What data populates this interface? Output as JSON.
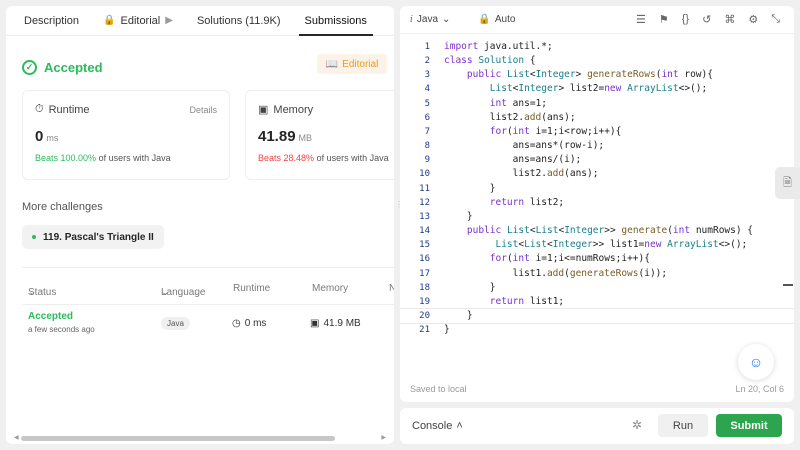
{
  "tabs": [
    {
      "label": "Description"
    },
    {
      "label": "Editorial"
    },
    {
      "label": "Solutions (11.9K)"
    },
    {
      "label": "Submissions"
    }
  ],
  "result": {
    "status": "Accepted",
    "editorial_label": "Editorial",
    "runtime": {
      "label": "Runtime",
      "details": "Details",
      "value": "0",
      "unit": "ms",
      "beats": "Beats 100.00%",
      "suffix": "of users with Java"
    },
    "memory": {
      "label": "Memory",
      "value": "41.89",
      "unit": "MB",
      "beats": "Beats 28.48%",
      "suffix": "of users with Java"
    }
  },
  "more_challenges": {
    "title": "More challenges",
    "items": [
      "119. Pascal's Triangle II"
    ]
  },
  "submissions_table": {
    "headers": [
      "Status",
      "Language",
      "Runtime",
      "Memory",
      "N"
    ],
    "rows": [
      {
        "status": "Accepted",
        "time": "a few seconds ago",
        "language": "Java",
        "runtime": "0 ms",
        "memory": "41.9 MB"
      }
    ]
  },
  "editor": {
    "language": "Java",
    "mode": "Auto",
    "lines": [
      "import java.util.*;",
      "class Solution {",
      "    public List<Integer> generateRows(int row){",
      "        List<Integer> list2=new ArrayList<>();",
      "        int ans=1;",
      "        list2.add(ans);",
      "        for(int i=1;i<row;i++){",
      "            ans=ans*(row-i);",
      "            ans=ans/(i);",
      "            list2.add(ans);",
      "        }",
      "        return list2;",
      "    }",
      "    public List<List<Integer>> generate(int numRows) {",
      "         List<List<Integer>> list1=new ArrayList<>();",
      "        for(int i=1;i<=numRows;i++){",
      "            list1.add(generateRows(i));",
      "        }",
      "        return list1;",
      "    }",
      "}"
    ],
    "saved": "Saved to local",
    "cursor": "Ln 20, Col 6"
  },
  "bottom": {
    "console": "Console",
    "run": "Run",
    "submit": "Submit"
  },
  "colors": {
    "accepted": "#2cbb5d",
    "beats_good": "#2cbb5d",
    "beats_bad": "#ef4743",
    "submit": "#2da44e",
    "editorial_accent": "#ffa116"
  }
}
